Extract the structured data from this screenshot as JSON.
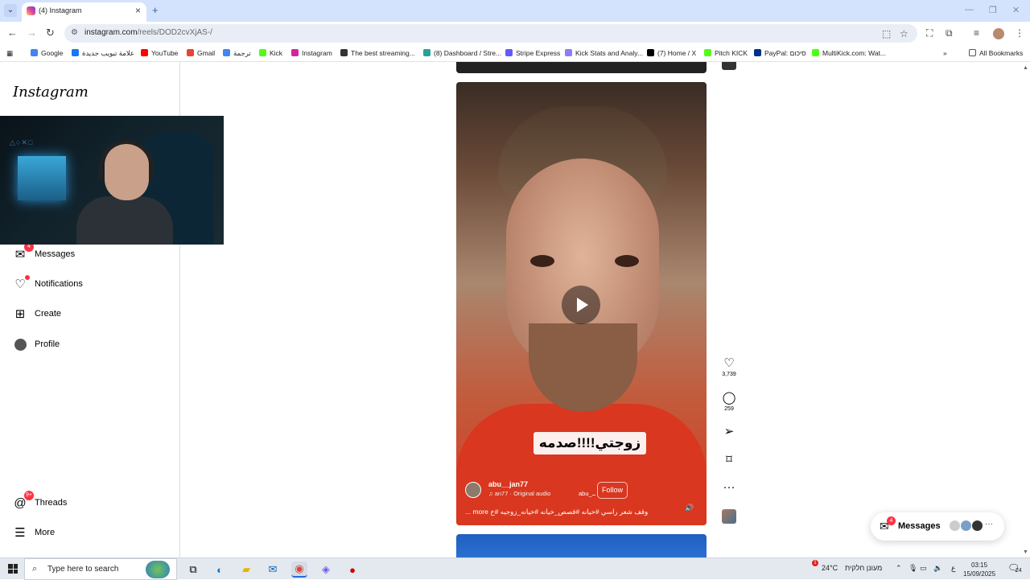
{
  "browser": {
    "tab_title": "(4) Instagram",
    "tab_close": "×",
    "new_tab": "+",
    "url_host": "instagram.com",
    "url_path": "/reels/DOD2cvXjAS-/",
    "bookmarks": [
      {
        "label": "Google",
        "color": "#4285f4"
      },
      {
        "label": "علامة تبويب جديدة",
        "color": "#1877f2"
      },
      {
        "label": "YouTube",
        "color": "#ff0000"
      },
      {
        "label": "Gmail",
        "color": "#ea4335"
      },
      {
        "label": "ترجمة",
        "color": "#4285f4"
      },
      {
        "label": "Kick",
        "color": "#53fc18"
      },
      {
        "label": "Instagram",
        "color": "#d6249f"
      },
      {
        "label": "The best streaming...",
        "color": "#333333"
      },
      {
        "label": "(8) Dashboard / Stre...",
        "color": "#2aa198"
      },
      {
        "label": "Stripe Express",
        "color": "#635bff"
      },
      {
        "label": "Kick Stats and Analy...",
        "color": "#8a7cff"
      },
      {
        "label": "(7) Home / X",
        "color": "#000000"
      },
      {
        "label": "Pitch KICK",
        "color": "#53fc18"
      },
      {
        "label": "PayPal: סיכום",
        "color": "#003087"
      },
      {
        "label": "MultiKick.com: Wat...",
        "color": "#53fc18"
      }
    ],
    "bookmarks_more": "»",
    "all_bookmarks": "All Bookmarks"
  },
  "sidebar": {
    "logo": "Instagram",
    "items": [
      {
        "label": "Messages",
        "badge": "4"
      },
      {
        "label": "Notifications"
      },
      {
        "label": "Create"
      },
      {
        "label": "Profile"
      },
      {
        "label": "Threads",
        "badge": "9+"
      },
      {
        "label": "More"
      }
    ]
  },
  "reel": {
    "caption_overlay": "زوجتي!!!!صدمه",
    "username": "abu__jan77",
    "audio": "an77 · Original audio",
    "audio_tag": "abu_ــ",
    "follow_label": "Follow",
    "description": "وقف شعر راسي #خيانه #قصص_خيانه #خيانه_زوجيه #خ",
    "more_label": "... more"
  },
  "actions": {
    "likes": "3,739",
    "comments": "259"
  },
  "messages_pill": {
    "label": "Messages",
    "badge": "4",
    "more": "···"
  },
  "taskbar": {
    "search_placeholder": "Type here to search",
    "weather_badge": "1",
    "temperature": "24°C",
    "weather_text": "מעונן חלקית",
    "lang": "ع",
    "time": "03:15",
    "date": "15/09/2025",
    "notification_count": "24"
  }
}
